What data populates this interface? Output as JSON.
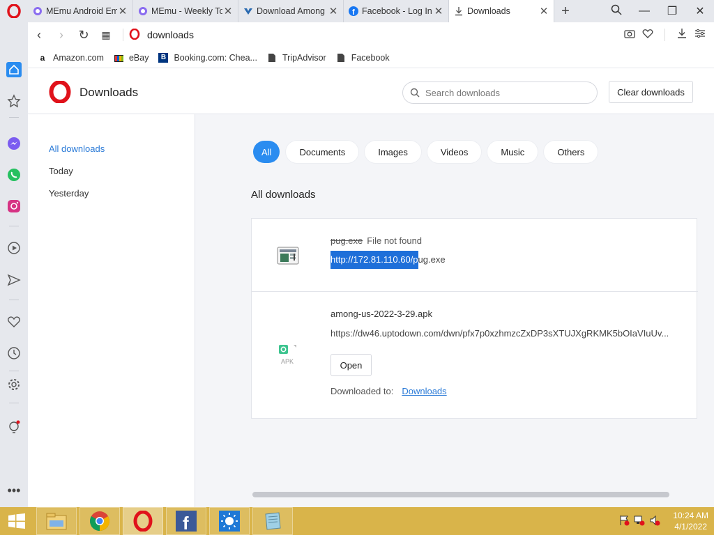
{
  "browser": {
    "tabs": [
      {
        "title": "MEmu Android Em",
        "icon": "memu-icon",
        "active": false
      },
      {
        "title": "MEmu - Weekly To",
        "icon": "memu-icon",
        "active": false
      },
      {
        "title": "Download Among",
        "icon": "uptodown-icon",
        "active": false
      },
      {
        "title": "Facebook - Log In",
        "icon": "facebook-icon",
        "active": false
      },
      {
        "title": "Downloads",
        "icon": "download-icon",
        "active": true
      }
    ],
    "address": "downloads",
    "bookmarks": [
      {
        "label": "Amazon.com",
        "icon": "amazon-icon"
      },
      {
        "label": "eBay",
        "icon": "ebay-icon"
      },
      {
        "label": "Booking.com: Chea...",
        "icon": "booking-icon"
      },
      {
        "label": "TripAdvisor",
        "icon": "page-icon"
      },
      {
        "label": "Facebook",
        "icon": "page-icon"
      }
    ]
  },
  "page": {
    "title": "Downloads",
    "search_placeholder": "Search downloads",
    "clear_label": "Clear downloads"
  },
  "leftnav": [
    {
      "label": "All downloads",
      "selected": true
    },
    {
      "label": "Today",
      "selected": false
    },
    {
      "label": "Yesterday",
      "selected": false
    }
  ],
  "filters": [
    "All",
    "Documents",
    "Images",
    "Videos",
    "Music",
    "Others"
  ],
  "active_filter": "All",
  "section_title": "All downloads",
  "downloads": [
    {
      "name": "pug.exe",
      "status": "File not found",
      "url_selected": "http://172.81.110.60/p",
      "url_rest": "ug.exe",
      "icon": "exe-file-icon"
    },
    {
      "name": "among-us-2022-3-29.apk",
      "url": "https://dw46.uptodown.com/dwn/pfx7p0xzhmzcZxDP3sXTUJXgRKMK5bOIaVIuUv...",
      "open_label": "Open",
      "downloaded_to_label": "Downloaded to:",
      "folder": "Downloads",
      "icon": "apk-file-icon",
      "icon_label": "APK"
    }
  ],
  "taskbar": {
    "time": "10:24 AM",
    "date": "4/1/2022"
  },
  "colors": {
    "accent": "#2a8cf0",
    "opera_red": "#e0121b",
    "taskbar": "#d9b44a"
  }
}
